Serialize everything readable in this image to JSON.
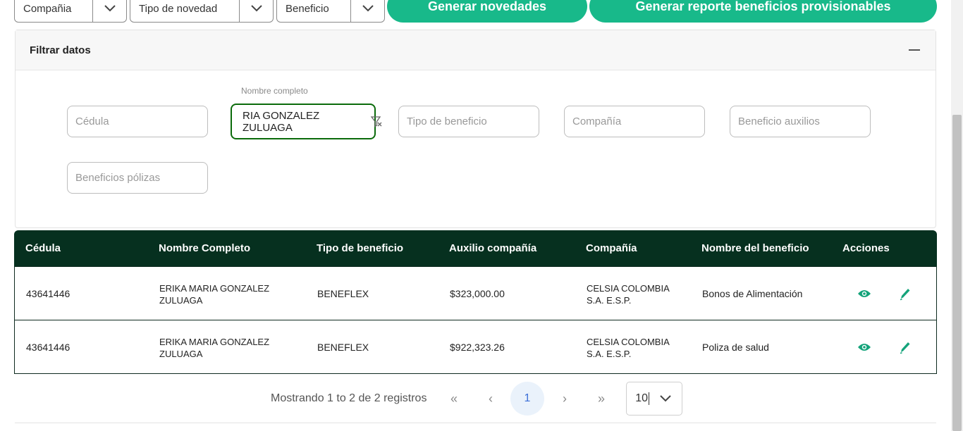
{
  "toolbar": {
    "company_select": "Compañia",
    "novelty_select": "Tipo de novedad",
    "benefit_select": "Beneficio",
    "generate_news_label": "Generar novedades",
    "generate_report_label": "Generar reporte beneficios provisionables"
  },
  "filter_panel": {
    "title": "Filtrar datos",
    "fields": {
      "cedula_placeholder": "Cédula",
      "name_label": "Nombre completo",
      "name_value": "RIA GONZALEZ ZULUAGA",
      "benefit_type_placeholder": "Tipo de beneficio",
      "company_placeholder": "Compañía",
      "aux_placeholder": "Beneficio auxilios",
      "policies_placeholder": "Beneficios pólizas"
    }
  },
  "table": {
    "headers": [
      "Cédula",
      "Nombre Completo",
      "Tipo de beneficio",
      "Auxilio compañía",
      "Compañía",
      "Nombre del beneficio",
      "Acciones"
    ],
    "rows": [
      {
        "cedula": "43641446",
        "name_1": "ERIKA MARIA GONZALEZ",
        "name_2": "ZULUAGA",
        "type": "BENEFLEX",
        "aux": "$323,000.00",
        "company_1": "CELSIA COLOMBIA",
        "company_2": "S.A. E.S.P.",
        "benefit": "Bonos de Alimentación"
      },
      {
        "cedula": "43641446",
        "name_1": "ERIKA MARIA GONZALEZ",
        "name_2": "ZULUAGA",
        "type": "BENEFLEX",
        "aux": "$922,323.26",
        "company_1": "CELSIA COLOMBIA",
        "company_2": "S.A. E.S.P.",
        "benefit": "Poliza de salud"
      }
    ]
  },
  "pagination": {
    "summary": "Mostrando 1 to 2 de 2 registros",
    "first": "«",
    "prev": "‹",
    "current": "1",
    "next": "›",
    "last": "»",
    "page_size": "10"
  },
  "colors": {
    "accent_green": "#18b98a",
    "table_header": "#06301f",
    "active_border": "#0b6b0b",
    "icon_green": "#14a37a"
  }
}
